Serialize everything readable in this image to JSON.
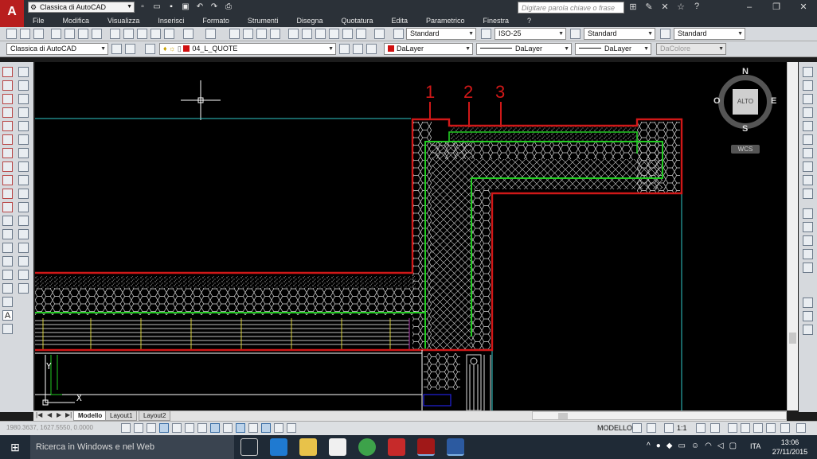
{
  "app": {
    "logo_letter": "A",
    "workspace": "Classica di AutoCAD",
    "search_placeholder": "Digitare parola chiave o frase"
  },
  "menu": [
    "File",
    "Modifica",
    "Visualizza",
    "Inserisci",
    "Formato",
    "Strumenti",
    "Disegna",
    "Quotatura",
    "Edita",
    "Parametrico",
    "Finestra",
    "?"
  ],
  "toolbar": {
    "text_style": "Standard",
    "dim_style": "ISO-25",
    "table_style": "Standard",
    "mleader_style": "Standard",
    "workspace2": "Classica di AutoCAD",
    "layer": "04_L_QUOTE",
    "color": "DaLayer",
    "linetype": "DaLayer",
    "lineweight": "DaLayer",
    "plotstyle": "DaColore"
  },
  "drawing": {
    "label_1": "1",
    "label_2": "2",
    "label_3": "3",
    "ucs_y": "Y",
    "ucs_x": "X"
  },
  "viewcube": {
    "n": "N",
    "s": "S",
    "e": "E",
    "o": "O",
    "face": "ALTO",
    "wcs": "WCS"
  },
  "tabs": {
    "model": "Modello",
    "layout1": "Layout1",
    "layout2": "Layout2"
  },
  "status": {
    "coords": "1980.3637, 1627.5550, 0.0000",
    "model": "MODELLO",
    "scale": "1:1"
  },
  "taskbar": {
    "search": "Ricerca in Windows e nel Web",
    "lang": "ITA",
    "time": "13:06",
    "date": "27/11/2015"
  },
  "colors": {
    "wall": "#d01818",
    "insulation": "#22cc22",
    "cyan": "#30c8c8"
  }
}
